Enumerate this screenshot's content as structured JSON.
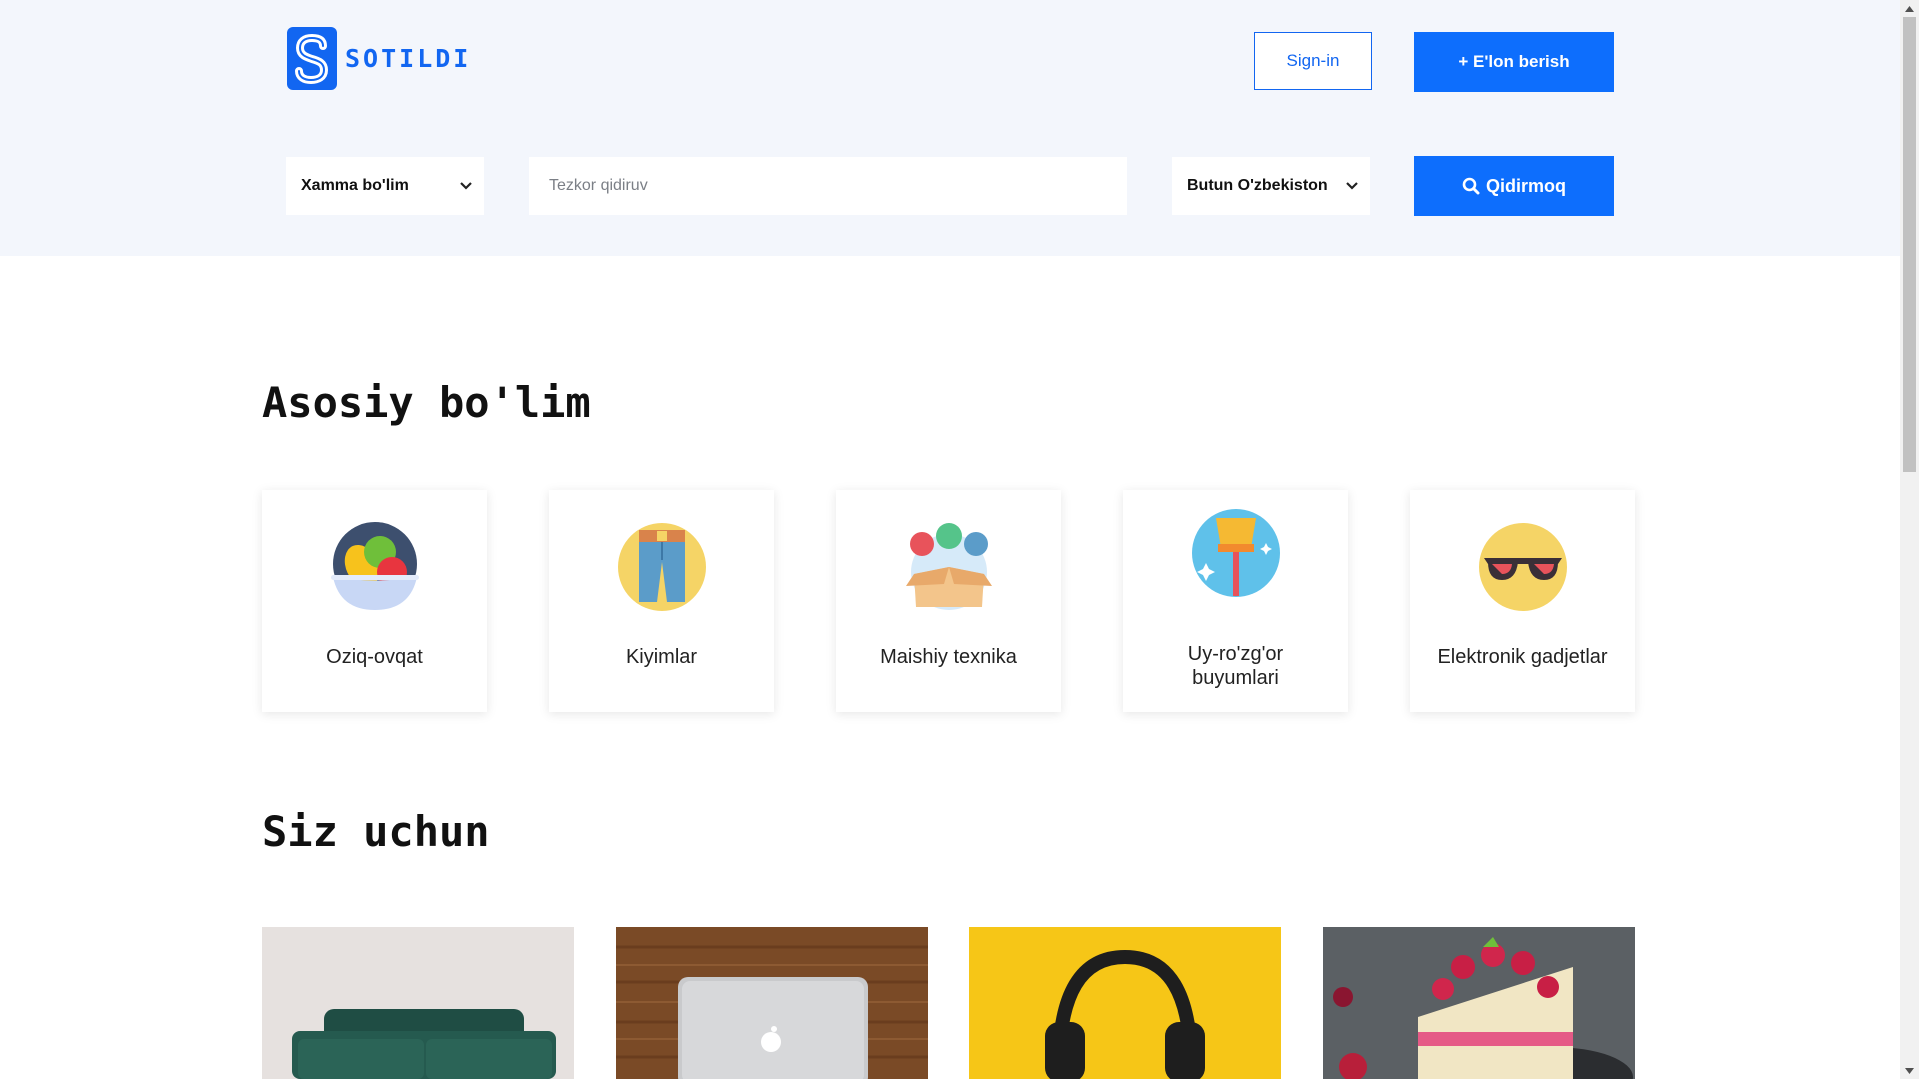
{
  "header": {
    "logo_text": "SOTILDI",
    "signin_label": "Sign-in",
    "post_ad_label": "+ E'lon berish",
    "category_select": "Xamma bo'lim",
    "search_placeholder": "Tezkor qidiruv",
    "region_select": "Butun O'zbekiston",
    "search_button_label": "Qidirmoq"
  },
  "main_section": {
    "title": "Asosiy bo'lim",
    "categories": [
      {
        "label": "Oziq-ovqat",
        "icon": "fruit-bowl-icon"
      },
      {
        "label": "Kiyimlar",
        "icon": "jeans-icon"
      },
      {
        "label": "Maishiy texnika",
        "icon": "box-of-goods-icon"
      },
      {
        "label": "Uy-ro'zg'or buyumlari",
        "icon": "broom-icon"
      },
      {
        "label": "Elektronik gadjetlar",
        "icon": "sunglasses-icon"
      }
    ]
  },
  "for_you_section": {
    "title": "Siz uchun",
    "products": [
      {
        "image": "green-sofa-photo"
      },
      {
        "image": "laptop-on-wood-photo"
      },
      {
        "image": "headphones-on-yellow-photo"
      },
      {
        "image": "raspberry-cake-photo"
      }
    ]
  },
  "colors": {
    "brand": "#1266f1",
    "primary_button": "#0d6efd",
    "header_bg": "#f3f6fc"
  }
}
